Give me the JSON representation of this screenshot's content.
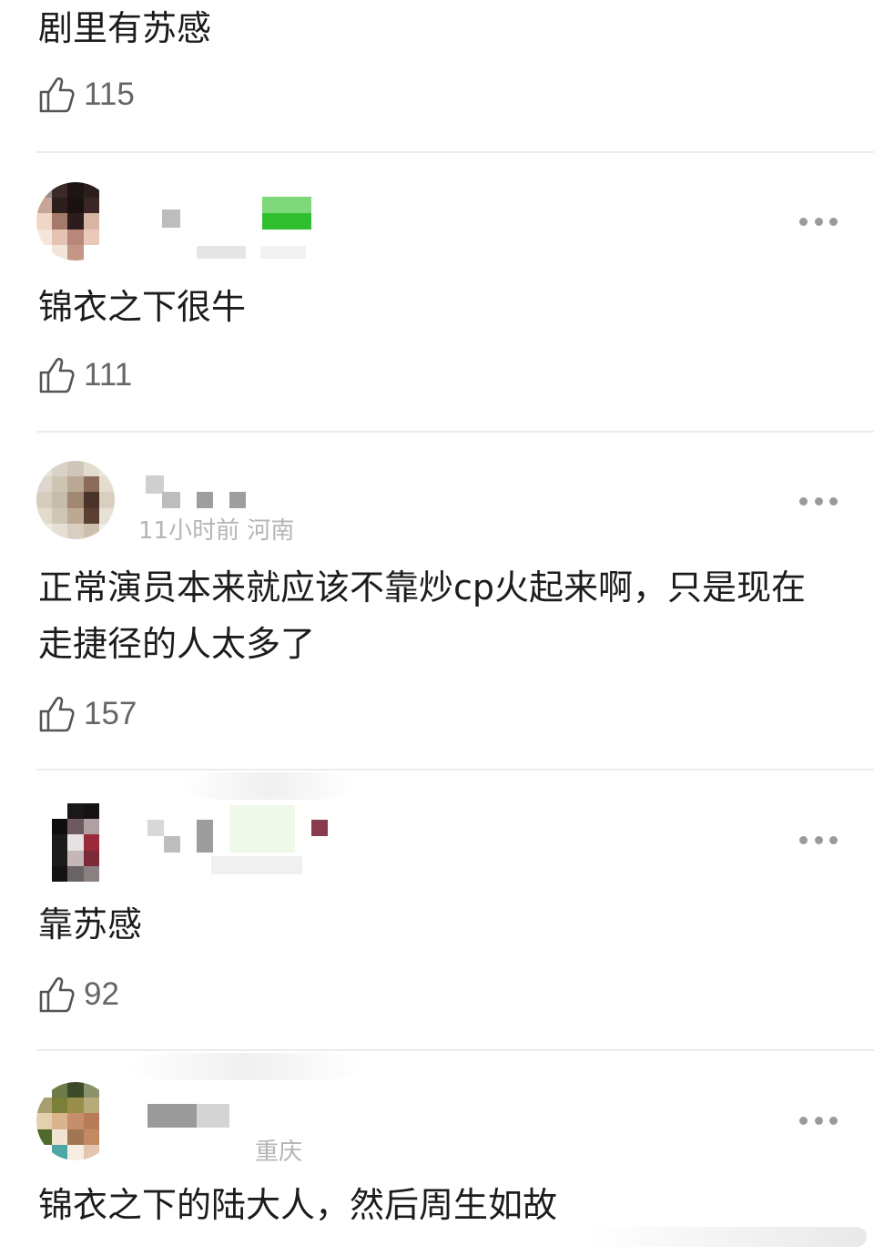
{
  "comments": [
    {
      "text": "剧里有苏感",
      "likes": "115"
    },
    {
      "text": "锦衣之下很牛",
      "likes": "111"
    },
    {
      "text": "正常演员本来就应该不靠炒cp火起来啊，只是现在走捷径的人太多了",
      "likes": "157",
      "meta": "11小时前 河南"
    },
    {
      "text": "靠苏感",
      "likes": "92"
    },
    {
      "text": "锦衣之下的陆大人，然后周生如故",
      "meta": "重庆"
    }
  ],
  "icons": {
    "like": "thumbs-up-icon",
    "more": "more-dots-icon"
  },
  "colors": {
    "text": "#1c1c1c",
    "muted": "#666666",
    "meta": "#b5b5b5",
    "divider": "#ececec"
  }
}
